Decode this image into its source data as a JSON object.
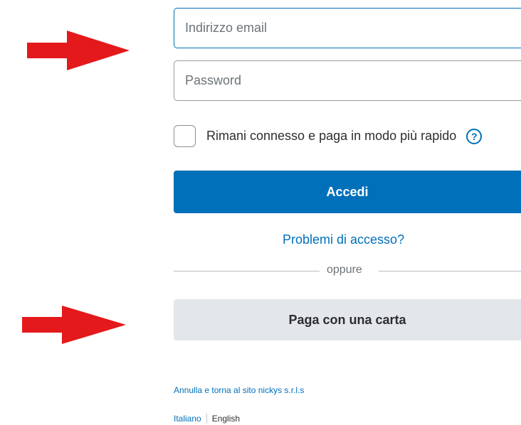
{
  "login_form": {
    "email_placeholder": "Indirizzo email",
    "password_placeholder": "Password",
    "remember_label": "Rimani connesso e paga in modo più rapido",
    "help_glyph": "?",
    "login_button": "Accedi",
    "trouble_link": "Problemi di accesso?",
    "divider_text": "oppure",
    "pay_with_card_button": "Paga con una carta"
  },
  "footer": {
    "cancel_link": "Annulla e torna al sito nickys s.r.l.s",
    "language_current": "Italiano",
    "language_other": "English"
  },
  "annotations": {
    "arrow_color": "#e3191b",
    "arrow_count": 2
  },
  "colors": {
    "primary_blue": "#0070ba",
    "secondary_button_bg": "#e3e6ea",
    "text_dark": "#2c2e2f",
    "text_muted": "#6c7378"
  },
  "icons": {
    "help": "question-circle-icon",
    "annotation": "red-arrow-icon"
  }
}
